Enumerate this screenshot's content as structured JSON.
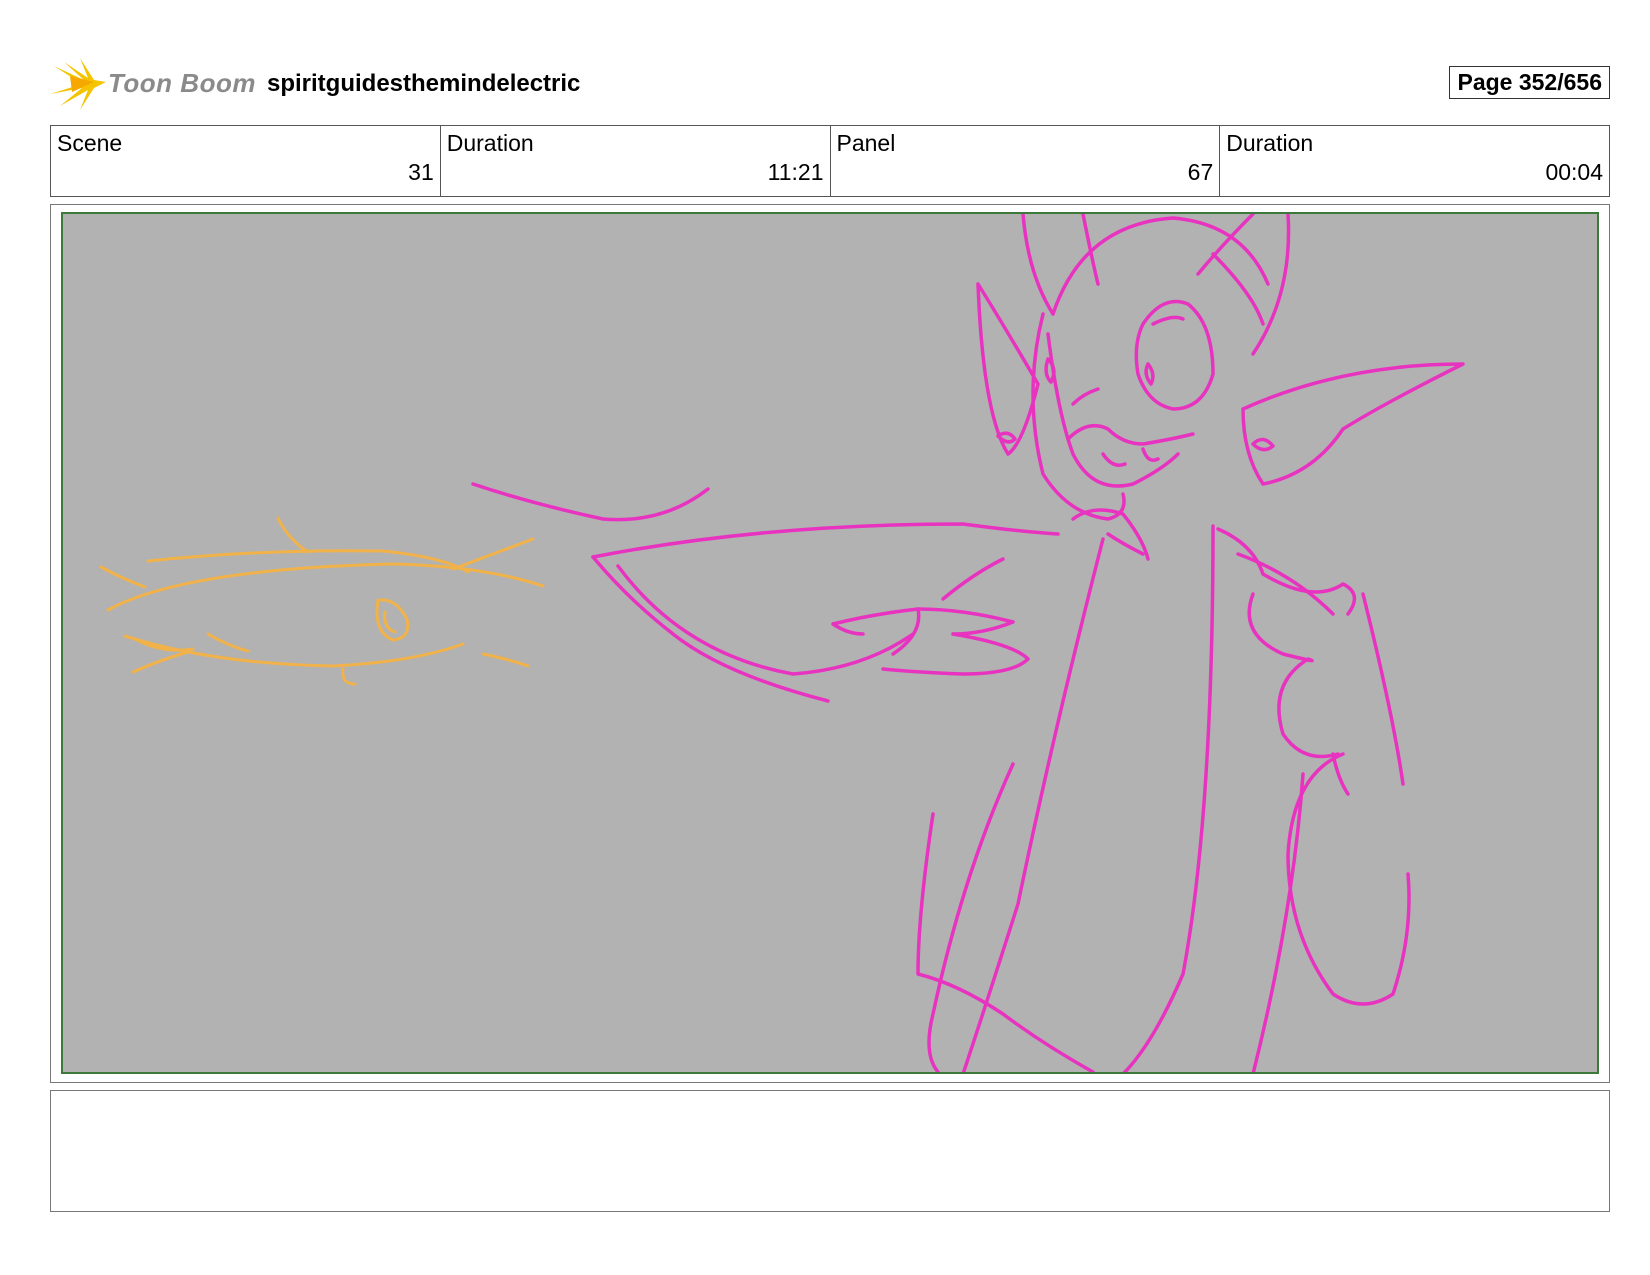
{
  "header": {
    "logo_text": "Toon Boom",
    "project_title": "spiritguidesthemindelectric",
    "page_label": "Page 352/656"
  },
  "info": [
    {
      "label": "Scene",
      "value": "31"
    },
    {
      "label": "Duration",
      "value": "11:21"
    },
    {
      "label": "Panel",
      "value": "67"
    },
    {
      "label": "Duration",
      "value": "00:04"
    }
  ],
  "colors": {
    "panel_background": "#b2b2b2",
    "panel_border": "#3c7a3c",
    "sketch_pink": "#e833c0",
    "sketch_orange": "#f2b24a",
    "logo_yellow": "#f5c400"
  },
  "icons": {
    "logo": "toon-boom-starburst-logo"
  },
  "notes": ""
}
